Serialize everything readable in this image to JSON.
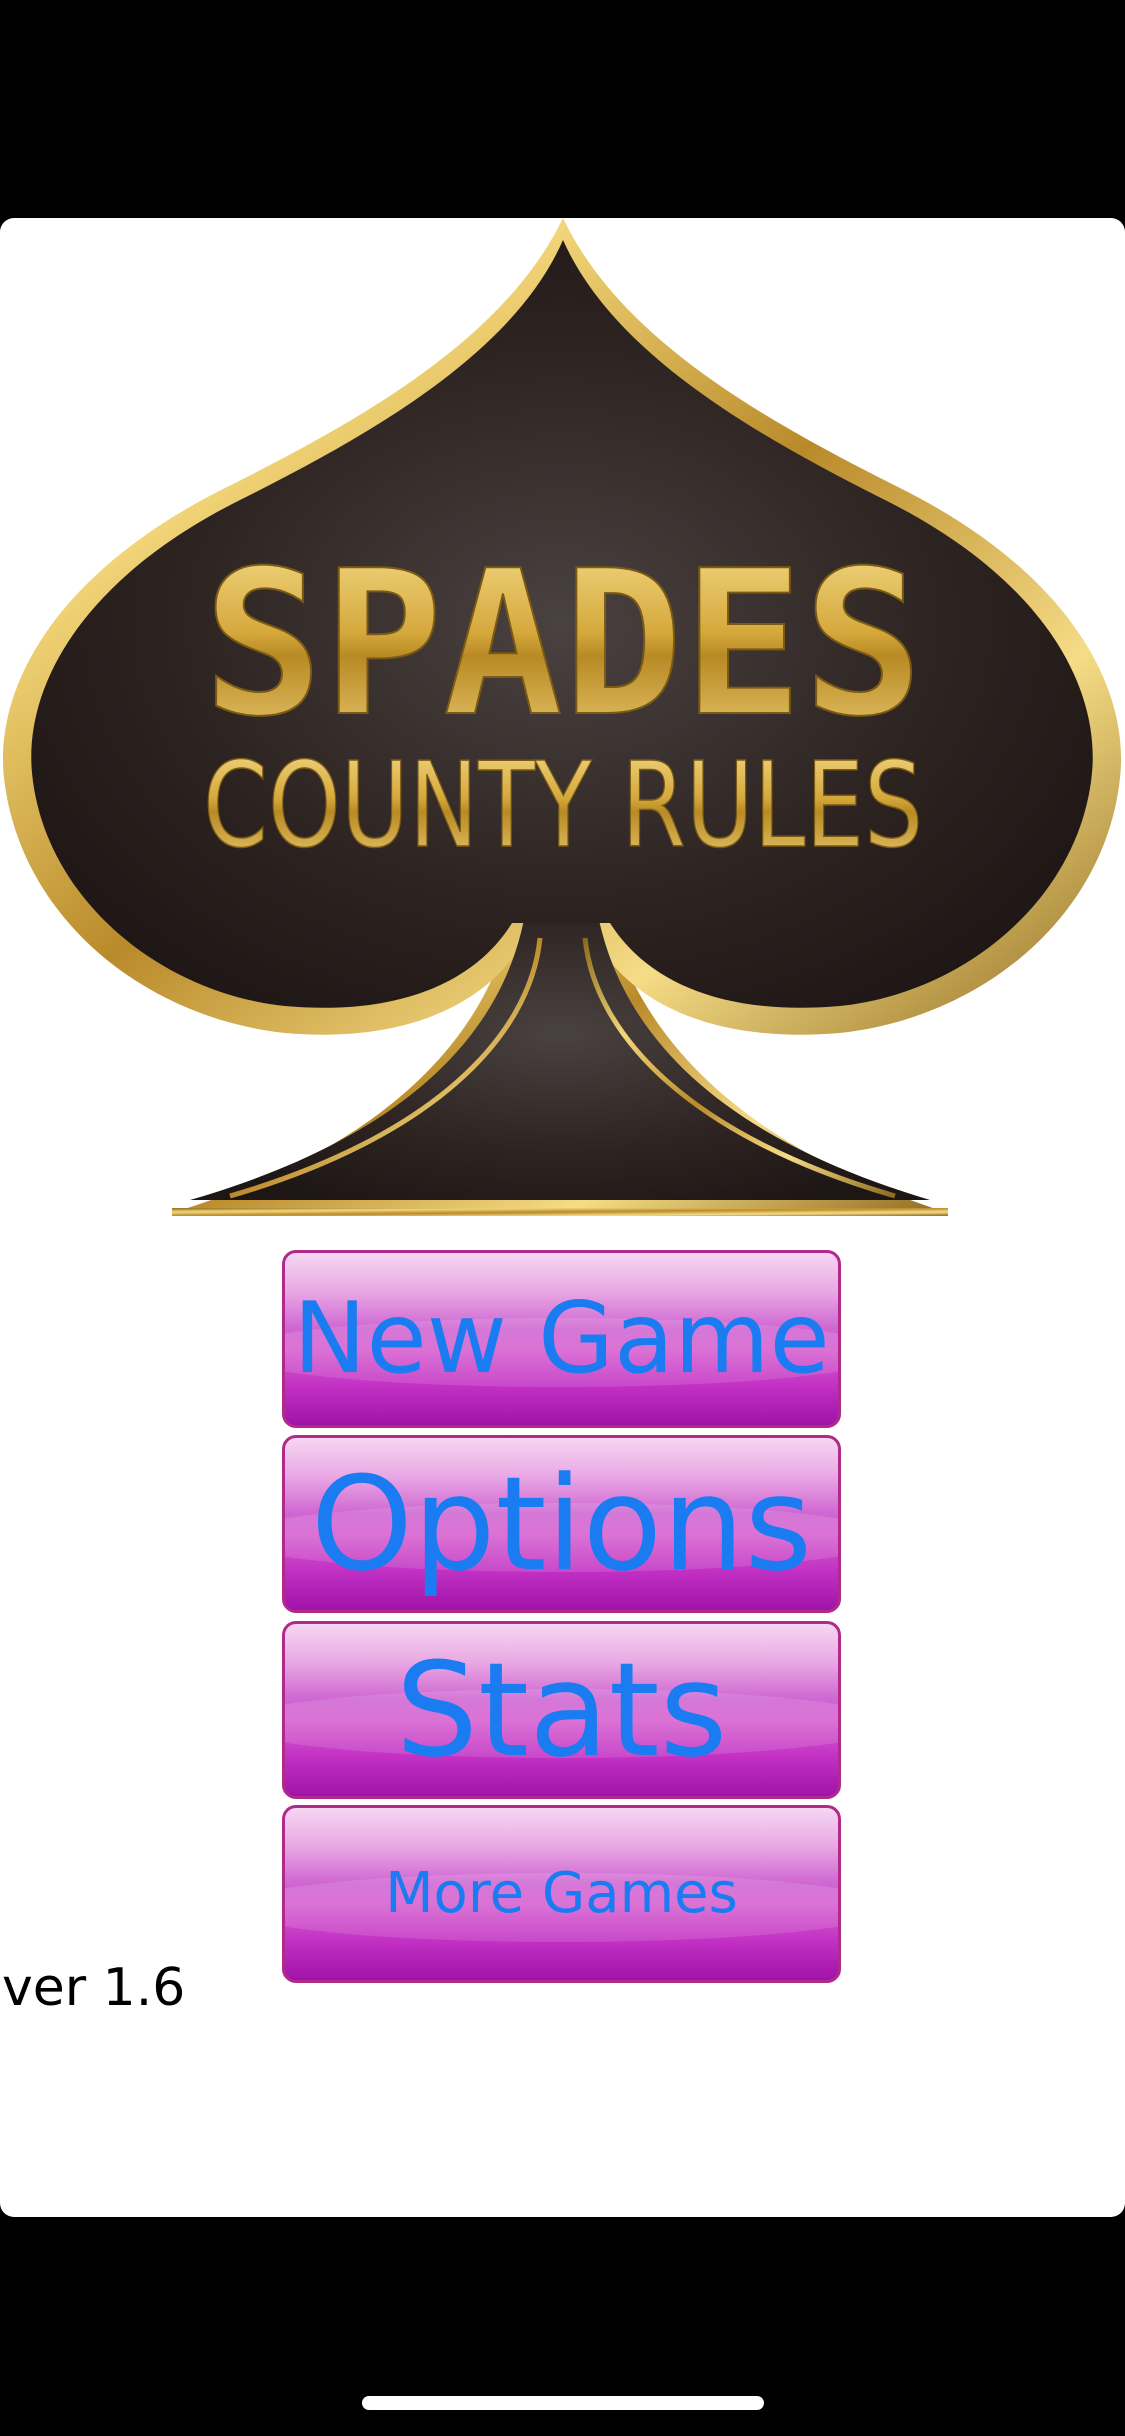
{
  "logo": {
    "title": "SPADES",
    "subtitle": "COUNTY RULES"
  },
  "menu": {
    "new_game": "New Game",
    "options": "Options",
    "stats": "Stats",
    "more_games": "More Games"
  },
  "version": "ver 1.6",
  "colors": {
    "button_label": "#1a7cf0",
    "button_top": "#f6d6f2",
    "button_bottom": "#a013a9",
    "spade_fill": "#2b2220",
    "gold": "#d8b24a"
  }
}
